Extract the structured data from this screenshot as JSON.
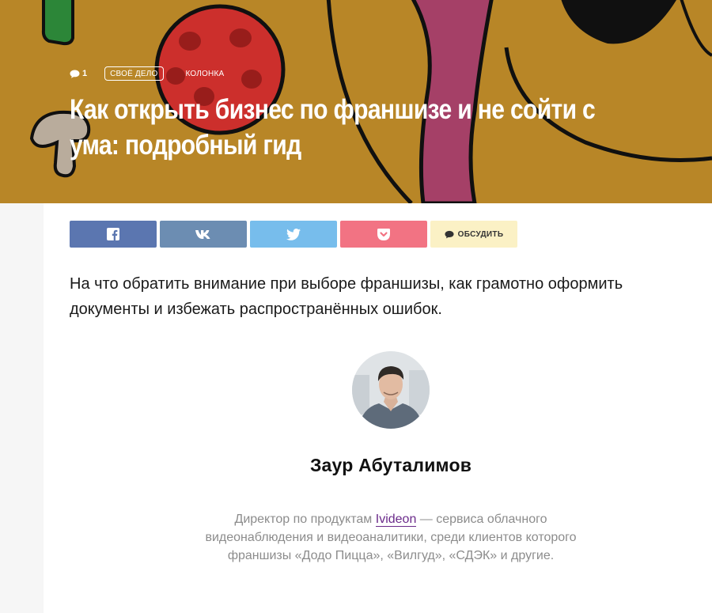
{
  "hero": {
    "comments_count": "1",
    "rubric": "СВОЁ ДЕЛО",
    "type": "КОЛОНКА",
    "title": "Как открыть бизнес по франшизе и не сойти с ума: подробный гид",
    "colors": {
      "background": "#c48f2a",
      "tomato": "#d9322f",
      "purple": "#b0456e",
      "green": "#2f8f3c"
    }
  },
  "share": {
    "buttons": [
      {
        "icon": "facebook-icon",
        "color": "#5b76b0"
      },
      {
        "icon": "vk-icon",
        "color": "#6c8db2"
      },
      {
        "icon": "twitter-icon",
        "color": "#77bdec"
      },
      {
        "icon": "pocket-icon",
        "color": "#f27383"
      }
    ],
    "discuss_label": "ОБСУДИТЬ"
  },
  "lead": "На что обратить внимание при выборе франшизы, как грамотно оформить документы и избежать распространённых ошибок.",
  "author": {
    "name": "Заур Абуталимов",
    "desc_before": "Директор по продуктам ",
    "company_link": "Ivideon",
    "desc_after": " — сервиса облачного видеонаблюдения и видеоаналитики, среди клиентов которого франшизы «Додо Пицца», «Вилгуд», «СДЭК» и другие."
  }
}
